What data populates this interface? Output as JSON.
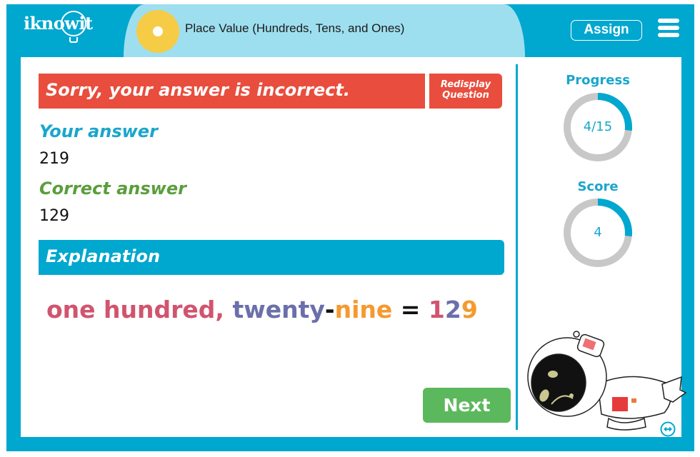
{
  "header": {
    "logo": "iknowit",
    "topic_title": "Place Value (Hundreds, Tens, and Ones)",
    "assign_label": "Assign",
    "menu_icon": "hamburger-menu-icon"
  },
  "feedback": {
    "result_message": "Sorry, your answer is incorrect.",
    "redisplay_label_line1": "Redisplay",
    "redisplay_label_line2": "Question",
    "your_answer_label": "Your answer",
    "your_answer_value": "219",
    "correct_answer_label": "Correct answer",
    "correct_answer_value": "129",
    "explanation_label": "Explanation",
    "explanation": {
      "parts": [
        {
          "text": "one hundred, ",
          "color": "#d1546f"
        },
        {
          "text": "twenty",
          "color": "#6b6faa"
        },
        {
          "text": "-",
          "color": "#111111"
        },
        {
          "text": "nine",
          "color": "#f59a2e"
        },
        {
          "text": " = ",
          "color": "#111111"
        },
        {
          "text": "1",
          "color": "#d1546f"
        },
        {
          "text": "2",
          "color": "#6b6faa"
        },
        {
          "text": "9",
          "color": "#f59a2e"
        }
      ]
    },
    "next_label": "Next"
  },
  "sidebar": {
    "progress_label": "Progress",
    "progress_text": "4/15",
    "progress_fraction": 0.2667,
    "score_label": "Score",
    "score_text": "4",
    "score_fraction": 0.2667,
    "expand_icon": "expand-horizontal-icon"
  },
  "colors": {
    "brand_blue": "#00a7cf",
    "banner_light_blue": "#9edfef",
    "incorrect_red": "#e84d3d",
    "correct_green": "#5a9e3c",
    "next_green": "#5cb85c",
    "ring_gray": "#c8c8c8",
    "topic_yellow": "#f6cb45"
  }
}
